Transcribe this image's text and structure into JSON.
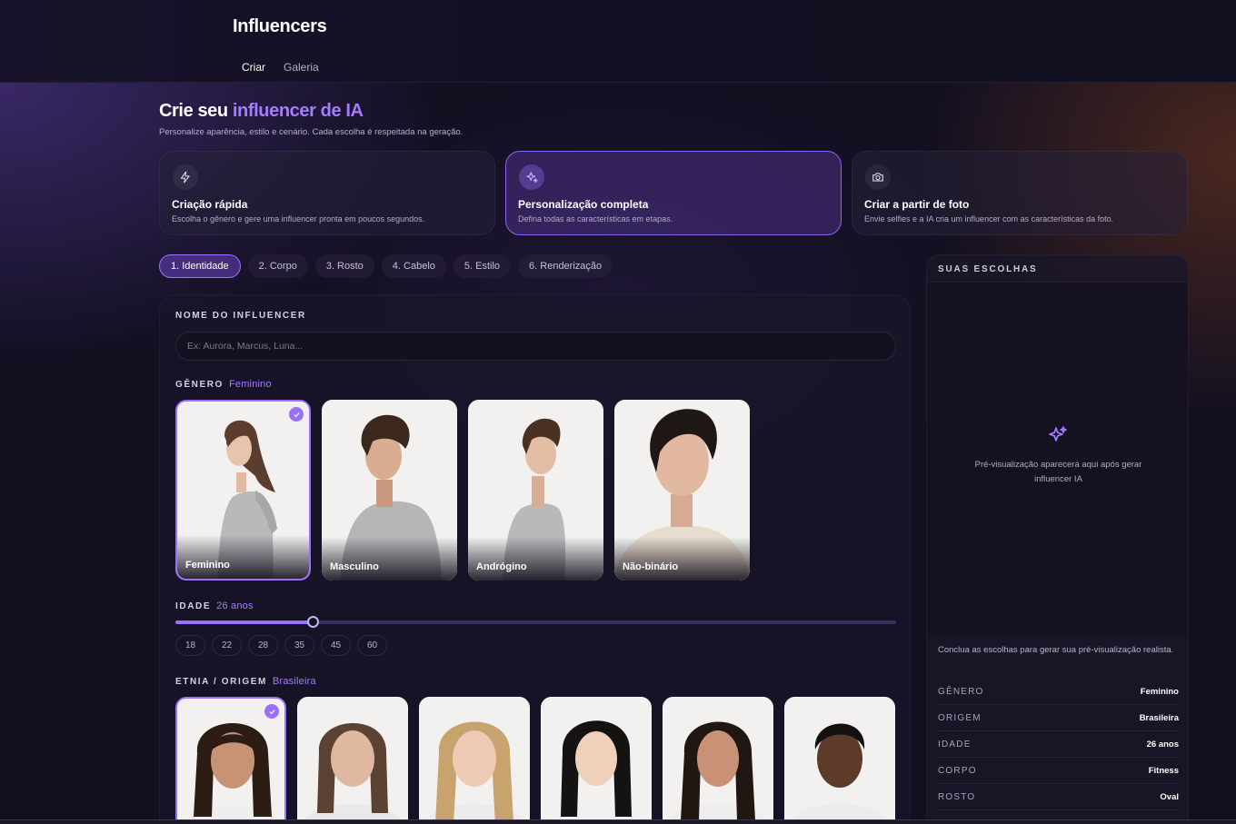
{
  "app": {
    "title": "Influencers"
  },
  "nav": [
    {
      "label": "Criar"
    },
    {
      "label": "Galeria"
    }
  ],
  "hero": {
    "title_start": "Crie seu ",
    "title_accent": "influencer de IA",
    "subtitle": "Personalize aparência, estilo e cenário. Cada escolha é respeitada na geração."
  },
  "modes": [
    {
      "title": "Criação rápida",
      "desc": "Escolha o gênero e gere uma influencer pronta em poucos segundos.",
      "icon": "lightning-icon"
    },
    {
      "title": "Personalização completa",
      "desc": "Defina todas as características em etapas.",
      "icon": "sparkles-icon"
    },
    {
      "title": "Criar a partir de foto",
      "desc": "Envie selfies e a IA cria um influencer com as características da foto.",
      "icon": "camera-icon"
    }
  ],
  "steps": [
    {
      "label": "1. Identidade"
    },
    {
      "label": "2. Corpo"
    },
    {
      "label": "3. Rosto"
    },
    {
      "label": "4. Cabelo"
    },
    {
      "label": "5. Estilo"
    },
    {
      "label": "6. Renderização"
    }
  ],
  "form": {
    "name_label": "NOME DO INFLUENCER",
    "name_placeholder": "Ex: Aurora, Marcus, Luna...",
    "gender_label": "GÊNERO",
    "gender_value": "Feminino",
    "genders": [
      {
        "label": "Feminino"
      },
      {
        "label": "Masculino"
      },
      {
        "label": "Andrógino"
      },
      {
        "label": "Não-binário"
      }
    ],
    "age_label": "IDADE",
    "age_value": "26 anos",
    "age_min": 18,
    "age_max": 60,
    "age_current": 26,
    "age_chips": [
      "18",
      "22",
      "28",
      "35",
      "45",
      "60"
    ],
    "ethnicity_label": "ETNIA / ORIGEM",
    "ethnicity_value": "Brasileira"
  },
  "sidebar": {
    "title": "SUAS ESCOLHAS",
    "preview_text": "Pré-visualização aparecerá aqui após gerar influencer IA",
    "note": "Conclua as escolhas para gerar sua pré-visualização realista.",
    "summary": [
      {
        "key": "GÊNERO",
        "value": "Feminino"
      },
      {
        "key": "ORIGEM",
        "value": "Brasileira"
      },
      {
        "key": "IDADE",
        "value": "26 anos"
      },
      {
        "key": "CORPO",
        "value": "Fitness"
      },
      {
        "key": "ROSTO",
        "value": "Oval"
      }
    ]
  },
  "colors": {
    "accent": "#9b70ff",
    "accent_text": "#a57bff",
    "background": "#120f20"
  }
}
